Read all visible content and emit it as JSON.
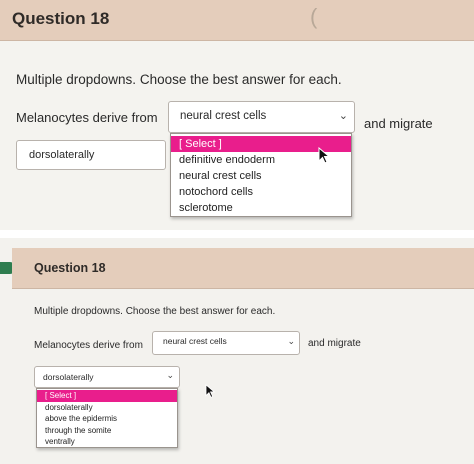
{
  "panel_top": {
    "question_title": "Question 18",
    "instructions": "Multiple dropdowns. Choose the best answer for each.",
    "label_derive": "Melanocytes derive from",
    "label_migrate": "and migrate",
    "select_origin_value": "neural crest cells",
    "select_direction_value": "dorsolaterally",
    "origin_options": [
      "[ Select ]",
      "definitive endoderm",
      "neural crest cells",
      "notochord cells",
      "sclerotome"
    ],
    "origin_highlighted": "[ Select ]"
  },
  "panel_bottom": {
    "question_title": "Question 18",
    "instructions": "Multiple dropdowns. Choose the best answer for each.",
    "label_derive": "Melanocytes derive from",
    "label_migrate": "and migrate",
    "select_origin_value": "neural crest cells",
    "select_direction_value": "dorsolaterally",
    "direction_options": [
      "[ Select ]",
      "dorsolaterally",
      "above the epidermis",
      "through the somite",
      "ventrally"
    ],
    "direction_highlighted": "[ Select ]"
  },
  "colors": {
    "header_band": "#e4cdbb",
    "highlight": "#e91e8c",
    "tab_marker": "#2e7d4f"
  }
}
